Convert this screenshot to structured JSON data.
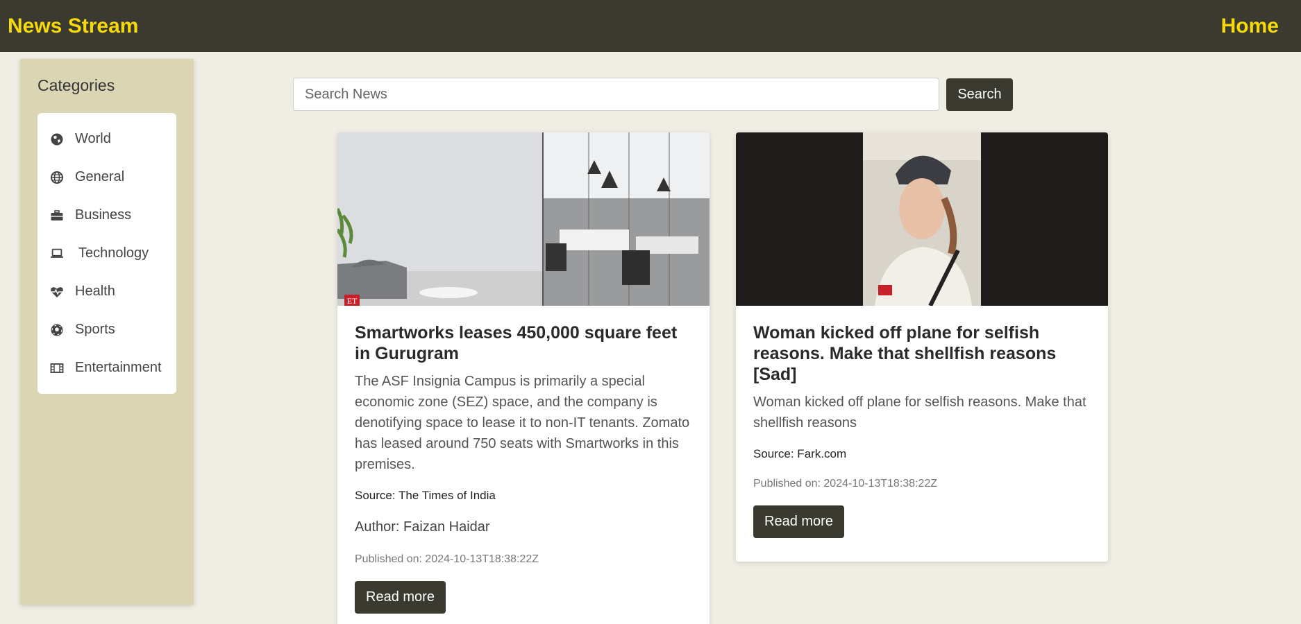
{
  "navbar": {
    "brand": "News Stream",
    "home": "Home"
  },
  "sidebar": {
    "title": "Categories",
    "items": [
      {
        "label": "World",
        "icon": "globe-africa-icon"
      },
      {
        "label": "General",
        "icon": "globe-icon"
      },
      {
        "label": "Business",
        "icon": "briefcase-icon"
      },
      {
        "label": "Technology",
        "icon": "laptop-icon"
      },
      {
        "label": "Health",
        "icon": "heartbeat-icon"
      },
      {
        "label": "Sports",
        "icon": "soccer-ball-icon"
      },
      {
        "label": "Entertainment",
        "icon": "film-icon"
      }
    ]
  },
  "search": {
    "placeholder": "Search News",
    "value": "",
    "button": "Search"
  },
  "articles": [
    {
      "title": "Smartworks leases 450,000 square feet in Gurugram",
      "description": "The ASF Insignia Campus is primarily a special economic zone (SEZ) space, and the company is denotifying space to lease it to non-IT tenants. Zomato has leased around 750 seats with Smartworks in this premises.",
      "source": "Source: The Times of India",
      "author": "Author: Faizan Haidar",
      "published": "Published on: 2024-10-13T18:38:22Z",
      "button": "Read more",
      "image_badge": "ET"
    },
    {
      "title": "Woman kicked off plane for selfish reasons. Make that shellfish reasons [Sad]",
      "description": "Woman kicked off plane for selfish reasons. Make that shellfish reasons",
      "source": "Source: Fark.com",
      "published": "Published on: 2024-10-13T18:38:22Z",
      "button": "Read more"
    }
  ],
  "colors": {
    "navbar": "#3b3a31",
    "brand": "#f5d90a",
    "sidebar": "#dad6b4",
    "background": "#f0ede4",
    "button": "#3b3a31"
  }
}
